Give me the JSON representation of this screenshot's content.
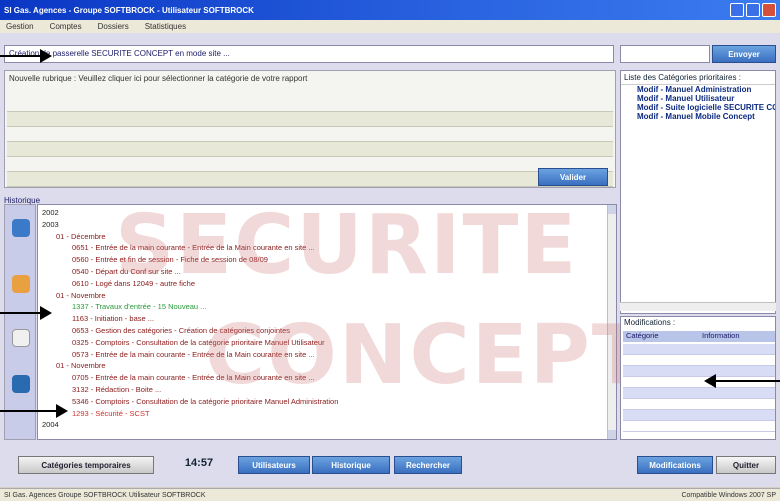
{
  "window": {
    "title": "SI Gas. Agences - Groupe SOFTBROCK - Utilisateur SOFTBROCK",
    "status_left": "SI Gas. Agences Groupe SOFTBROCK Utilisateur SOFTBROCK",
    "status_right": "Compatible Windows 2007 SP"
  },
  "menu": [
    "Gestion",
    "Comptes",
    "Dossiers",
    "Statistiques"
  ],
  "search_line": "Création de passerelle SECURITE CONCEPT en mode site ...",
  "top_buttons": {
    "envoyer": "Envoyer",
    "valider": "Valider"
  },
  "comment_prompt": "Nouvelle rubrique : Veuillez cliquer ici pour sélectionner la catégorie de votre rapport",
  "categories": {
    "title": "Liste des Catégories prioritaires :",
    "items": [
      "Modif - Manuel Administration",
      "Modif - Manuel Utilisateur",
      "Modif - Suite logicielle SECURITE CONCEPT",
      "Modif - Manuel Mobile Concept"
    ]
  },
  "tree": {
    "header": "Historique",
    "rows": [
      {
        "text": "2002",
        "color": "#222222"
      },
      {
        "text": "2003",
        "color": "#222222"
      },
      {
        "text": "01 - Décembre",
        "color": "#8a1a1a"
      },
      {
        "text": "0651 - Entrée de la main courante - Entrée de la Main courante en site ...",
        "color": "#8a1a1a"
      },
      {
        "text": "0560 - Entrée et fin de session - Fiche de session de 08/09",
        "color": "#8a1a1a"
      },
      {
        "text": "0540 - Départ du Conf sur site ...",
        "color": "#8a1a1a"
      },
      {
        "text": "0610 - Logé dans 12049 - autre fiche",
        "color": "#8a1a1a"
      },
      {
        "text": "01 - Novembre",
        "color": "#8a1a1a"
      },
      {
        "text": "1337 - Travaux d'entrée - 15 Nouveau ...",
        "color": "#2a9a3a"
      },
      {
        "text": "1163 - Initiation - base ...",
        "color": "#8a1a1a"
      },
      {
        "text": "0653 - Gestion des catégories - Création de catégories conjointes",
        "color": "#8a1a1a"
      },
      {
        "text": "0325 - Comptoirs - Consultation de la catégorie prioritaire Manuel Utilisateur",
        "color": "#8a1a1a"
      },
      {
        "text": "0573 - Entrée de la main courante - Entrée de la Main courante en site ...",
        "color": "#8a1a1a"
      },
      {
        "text": "01 - Novembre",
        "color": "#8a1a1a"
      },
      {
        "text": "0705 - Entrée de la main courante - Entrée de la Main courante en site ...",
        "color": "#8a1a1a"
      },
      {
        "text": "3132 - Rédaction - Boite ...",
        "color": "#8a1a1a"
      },
      {
        "text": "5346 - Comptoirs - Consultation de la catégorie prioritaire Manuel Administration",
        "color": "#8a1a1a"
      },
      {
        "text": "1293 - Sécurité - SCST",
        "color": "#d03030"
      },
      {
        "text": "2004",
        "color": "#222222"
      }
    ]
  },
  "watermark": [
    "SECURITE",
    "CONCEPT"
  ],
  "grid": {
    "title": "Modifications :",
    "columns": [
      "Catégorie",
      "Information"
    ]
  },
  "bottom": {
    "categories_button": "Catégories temporaires",
    "time": "14:57",
    "b1": "Utilisateurs",
    "b2": "Historique",
    "b3": "Rechercher",
    "b4": "Modifications",
    "quit": "Quitter"
  },
  "colors": {
    "titlebar": "#0a36c4",
    "button_blue": "#3a6fc0",
    "arrow": "#000000"
  }
}
